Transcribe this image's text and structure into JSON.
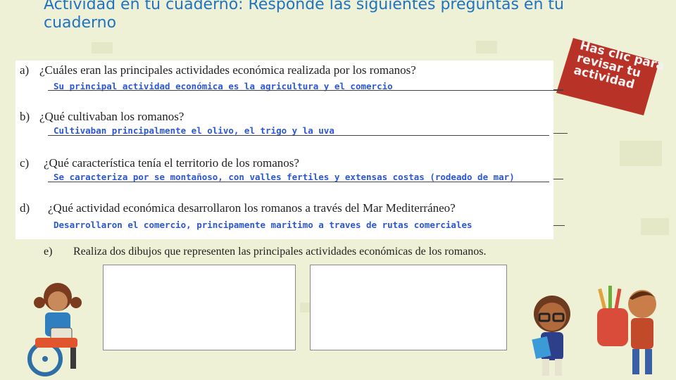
{
  "title": "Actividad en tu cuaderno: Responde las siguientes preguntas en tu cuaderno",
  "note": "Has clic para revisar tu actividad",
  "questions": [
    {
      "letter": "a)",
      "question": "¿Cuáles eran las principales  actividades económica realizada por los romanos?",
      "answer": "Su principal actividad económica es la agricultura y el comercio"
    },
    {
      "letter": "b)",
      "question": "¿Qué cultivaban los romanos?",
      "answer": "Cultivaban principalmente el olivo, el trigo y la uva"
    },
    {
      "letter": "c)",
      "question": "¿Qué característica tenía el territorio de los romanos?",
      "answer": "Se caracteriza por se montañoso, con valles fertiles y extensas costas (rodeado de mar)"
    },
    {
      "letter": "d)",
      "question": "¿Qué actividad económica desarrollaron los romanos a través del Mar Mediterráneo?",
      "answer": "Desarrollaron el comercio, principamente maritimo a traves de rutas comerciales"
    }
  ],
  "task_e": {
    "letter": "e)",
    "text": "Realiza dos dibujos que representen las principales actividades económicas de los romanos."
  },
  "colors": {
    "title": "#1f73c4",
    "answer": "#2b57d6",
    "background": "#eef1d6",
    "bubble": "#c0392b"
  },
  "icons": [
    "girl-wheelchair-illustration",
    "boy-books-illustration",
    "child-backpack-illustration"
  ]
}
